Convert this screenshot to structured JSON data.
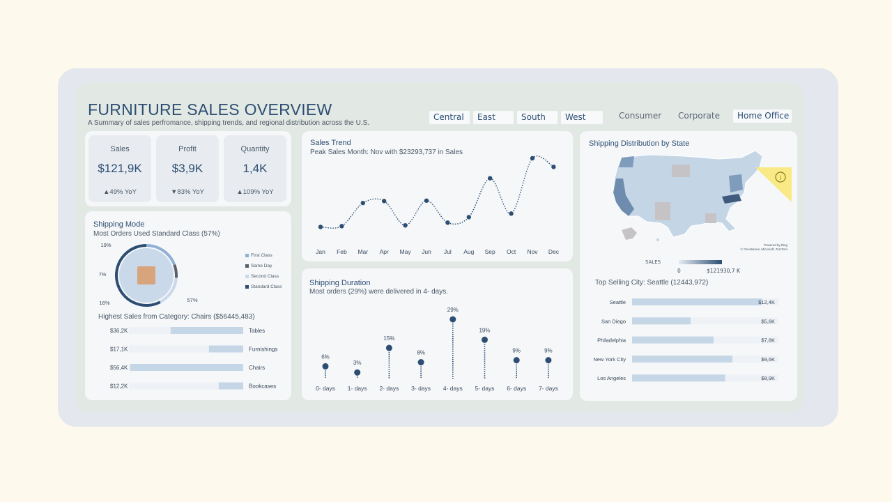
{
  "header": {
    "title": "FURNITURE SALES OVERVIEW",
    "subtitle": "A Summary of sales perfromance, shipping trends, and regional distribution across the U.S."
  },
  "filters": {
    "regions": [
      "Central",
      "East",
      "South",
      "West"
    ],
    "segments": [
      "Consumer",
      "Corporate",
      "Home Office"
    ]
  },
  "kpis": [
    {
      "label": "Sales",
      "value": "$121,9K",
      "yoy": "▲49% YoY"
    },
    {
      "label": "Profit",
      "value": "$3,9K",
      "yoy": "▼83% YoY"
    },
    {
      "label": "Quantity",
      "value": "1,4K",
      "yoy": "▲109% YoY"
    }
  ],
  "shipping_mode": {
    "title": "Shipping Mode",
    "subtitle": "Most Orders Used Standard Class (57%)",
    "legend": [
      "First Class",
      "Same Day",
      "Second Class",
      "Standard Class"
    ],
    "colors": [
      "#8fb0d6",
      "#5a6068",
      "#c9d8ea",
      "#2d4e72"
    ],
    "pct_labels": [
      "19%",
      "7%",
      "16%",
      "57%"
    ],
    "chart_data": {
      "type": "pie",
      "labels": [
        "First Class",
        "Same Day",
        "Second Class",
        "Standard Class"
      ],
      "values": [
        19,
        7,
        16,
        57
      ]
    }
  },
  "category": {
    "title": "Highest Sales from Category: Chairs ($56445,483)",
    "chart_data": {
      "type": "bar",
      "categories": [
        "Tables",
        "Furnishings",
        "Chairs",
        "Bookcases"
      ],
      "values": [
        36.2,
        17.1,
        56.4,
        12.2
      ],
      "value_labels": [
        "$36,2K",
        "$17,1K",
        "$56,4K",
        "$12,2K"
      ]
    }
  },
  "sales_trend": {
    "title": "Sales Trend",
    "subtitle": "Peak Sales Month: Nov with $23293,737 in Sales",
    "chart_data": {
      "type": "line",
      "categories": [
        "Jan",
        "Feb",
        "Mar",
        "Apr",
        "May",
        "Jun",
        "Jul",
        "Aug",
        "Sep",
        "Oct",
        "Nov",
        "Dec"
      ],
      "values": [
        5800,
        6000,
        11900,
        12400,
        6200,
        12500,
        6900,
        8300,
        18200,
        9200,
        23294,
        21100
      ]
    }
  },
  "shipping_duration": {
    "title": "Shipping Duration",
    "subtitle": "Most orders (29%) were delivered in 4- days.",
    "chart_data": {
      "type": "bar",
      "categories": [
        "0- days",
        "1- days",
        "2- days",
        "3- days",
        "4- days",
        "5- days",
        "6- days",
        "7- days"
      ],
      "values": [
        6,
        3,
        15,
        8,
        29,
        19,
        9,
        9
      ],
      "value_labels": [
        "6%",
        "3%",
        "15%",
        "8%",
        "29%",
        "19%",
        "9%",
        "9%"
      ]
    }
  },
  "map": {
    "title": "Shipping Distribution by State",
    "powered": "Powered by Bing",
    "copyright": "© GeoNames, Microsoft, TomTom",
    "legend_title": "SALES",
    "legend_min": "0",
    "legend_max": "$121930,7 K",
    "info_icon": "info-icon"
  },
  "cities": {
    "title": "Top Selling City: Seattle (12443,972)",
    "chart_data": {
      "type": "bar",
      "categories": [
        "Seattle",
        "San Diego",
        "Philadelphia",
        "New York City",
        "Los Angeles"
      ],
      "values": [
        12.4,
        5.6,
        7.8,
        9.6,
        8.9
      ],
      "value_labels": [
        "$12,4K",
        "$5,6K",
        "$7,8K",
        "$9,6K",
        "$8,9K"
      ]
    }
  }
}
